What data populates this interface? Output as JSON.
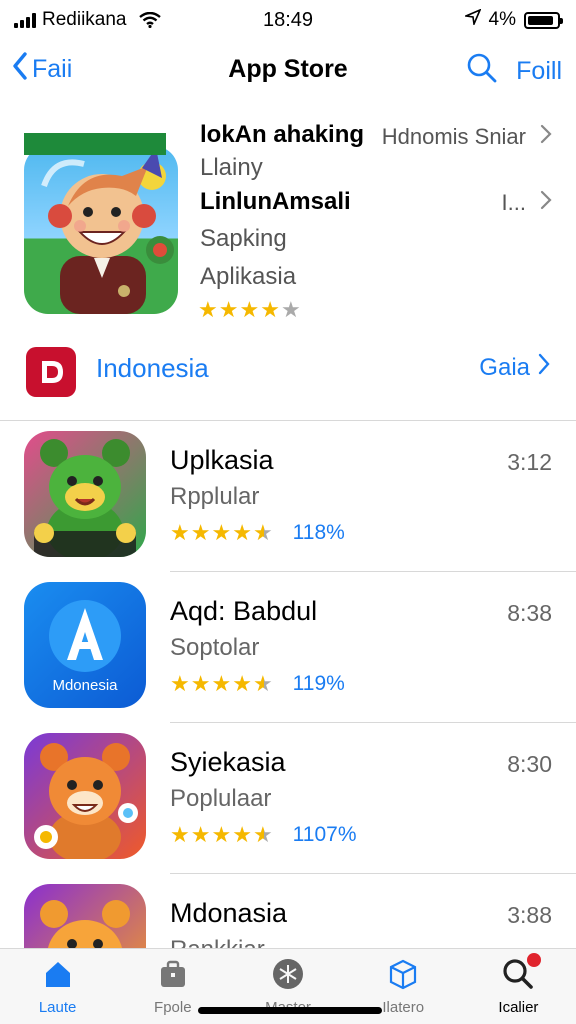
{
  "status_bar": {
    "carrier": "Rediikana",
    "time": "18:49",
    "battery": "4%",
    "battery_level": 0.9
  },
  "nav": {
    "back_label": "Faii",
    "title": "App Store",
    "right_label": "Foill"
  },
  "featured": {
    "line1": "lokAn ahaking",
    "line1_right": "Hdnomis Sniar",
    "line2": "Llainy",
    "line3": "LinlunAmsali",
    "line3_right": "I...",
    "line4": "Sapking",
    "line5": "Aplikasia",
    "stars_filled": 4,
    "stars_total": 5
  },
  "region": {
    "label": "Indonesia",
    "link": "Gaia"
  },
  "apps": [
    {
      "name": "Uplkasia",
      "subtitle": "Rpplular",
      "rating_text": "118%",
      "time": "3:12",
      "stars": 4.5,
      "icon_colors": [
        "#e34c8c",
        "#2fa84a"
      ],
      "icon_label": ""
    },
    {
      "name": "Aqd: Babdul",
      "subtitle": "Soptolar",
      "rating_text": "119%",
      "time": "8:38",
      "stars": 4.5,
      "icon_colors": [
        "#1a8df0",
        "#0c5bd4"
      ],
      "icon_label": "Mdonesia"
    },
    {
      "name": "Syiekasia",
      "subtitle": "Poplulaar",
      "rating_text": "1107%",
      "time": "8:30",
      "stars": 4.5,
      "icon_colors": [
        "#7a39d8",
        "#f05a28"
      ],
      "icon_label": ""
    },
    {
      "name": "Mdonasia",
      "subtitle": "Rankkiar",
      "rating_text": "",
      "time": "3:88",
      "stars": 0,
      "icon_colors": [
        "#8a2fd0",
        "#f7a020"
      ],
      "icon_label": ""
    }
  ],
  "tabs": [
    {
      "label": "Laute",
      "icon": "home-icon",
      "active": true
    },
    {
      "label": "Fpole",
      "icon": "briefcase-icon",
      "active": false
    },
    {
      "label": "Mastor",
      "icon": "globe-icon",
      "active": false
    },
    {
      "label": "Ilatero",
      "icon": "box-icon",
      "active": false
    },
    {
      "label": "Icalier",
      "icon": "search-icon",
      "active": false
    }
  ],
  "colors": {
    "accent": "#1a7cf2",
    "star": "#f5b800",
    "badge": "#e0242d"
  }
}
